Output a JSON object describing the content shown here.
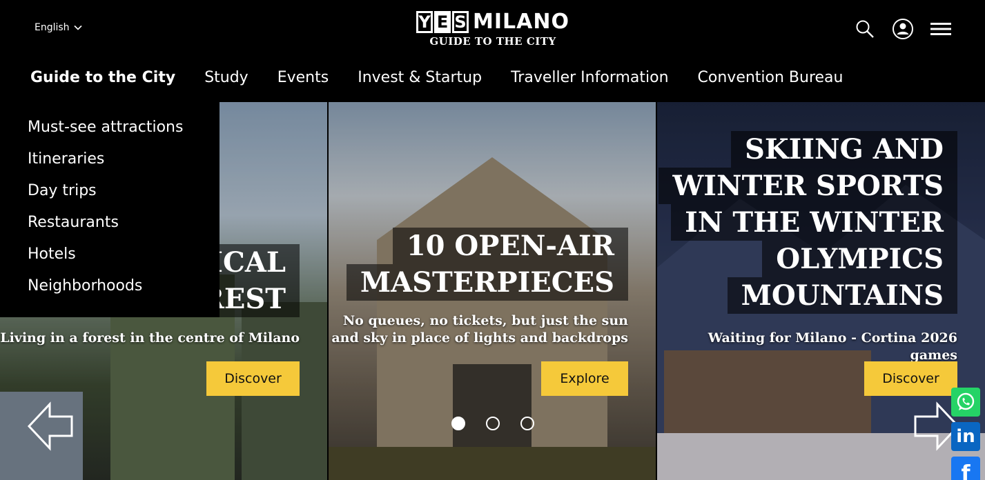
{
  "header": {
    "language": "English",
    "logo": {
      "letters": [
        "Y",
        "E",
        "S"
      ],
      "word": "MILANO",
      "tagline": "GUIDE TO THE CITY"
    }
  },
  "nav": {
    "items": [
      "Guide to the City",
      "Study",
      "Events",
      "Invest & Startup",
      "Traveller Information",
      "Convention Bureau"
    ]
  },
  "dropdown": {
    "items": [
      "Must-see attractions",
      "Itineraries",
      "Day trips",
      "Restaurants",
      "Hotels",
      "Neighborhoods"
    ]
  },
  "slides": [
    {
      "headline_lines": [
        "ICAL",
        "REST"
      ],
      "subtitle_lines": [
        "Living in a forest in the centre of Milano"
      ],
      "cta": "Discover"
    },
    {
      "headline_lines": [
        "10 OPEN-AIR",
        "MASTERPIECES"
      ],
      "subtitle_lines": [
        "No queues, no tickets, but just the sun",
        "and sky in place of lights and backdrops"
      ],
      "cta": "Explore"
    },
    {
      "headline_lines": [
        "SKIING AND",
        "WINTER SPORTS",
        "IN THE WINTER",
        "OLYMPICS",
        "MOUNTAINS"
      ],
      "subtitle_lines": [
        "Waiting for Milano - Cortina 2026 games"
      ],
      "cta": "Discover"
    }
  ],
  "carousel": {
    "active_index": 0,
    "count": 3
  },
  "colors": {
    "accent": "#f5c93a",
    "whatsapp": "#25d366",
    "linkedin": "#0a66c2",
    "facebook": "#1877f2"
  },
  "icons": [
    "chevron-down-icon",
    "search-icon",
    "user-icon",
    "menu-icon",
    "arrow-left-icon",
    "arrow-right-icon",
    "whatsapp-icon",
    "linkedin-icon",
    "facebook-icon"
  ],
  "social": {
    "linkedin_text": "in",
    "facebook_text": "f"
  }
}
